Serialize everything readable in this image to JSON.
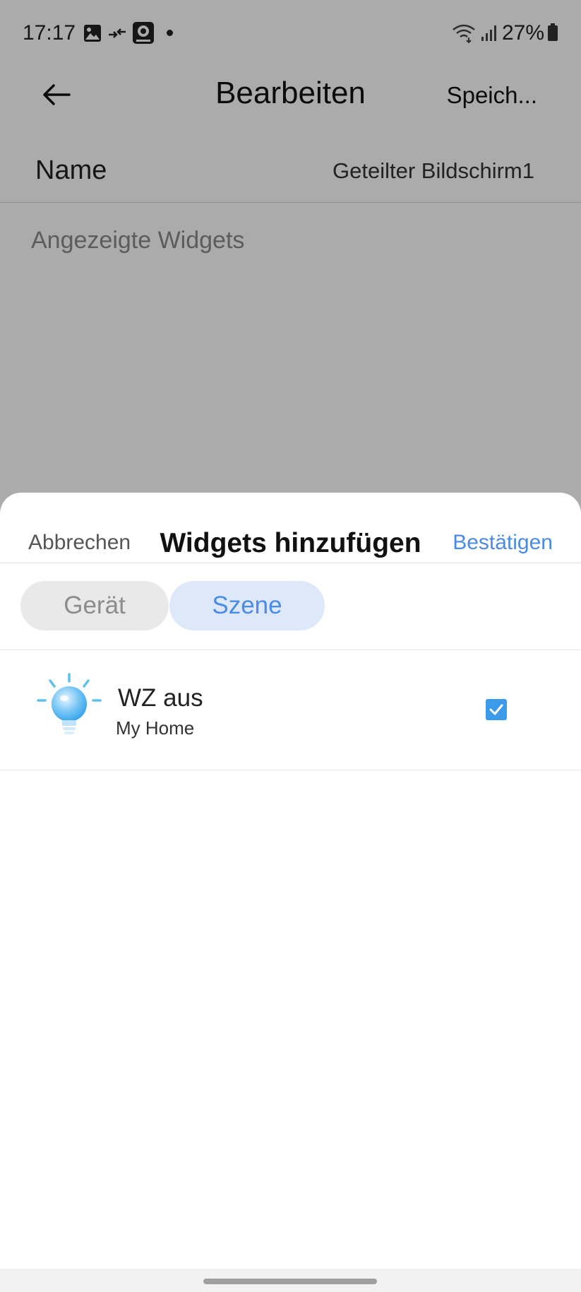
{
  "status_bar": {
    "time": "17:17",
    "battery": "27%",
    "icons": [
      "gallery-icon",
      "transfer-icon",
      "camera-app-icon",
      "wifi-icon",
      "signal-icon",
      "battery-icon"
    ]
  },
  "header": {
    "back_icon": "arrow-left-icon",
    "title": "Bearbeiten",
    "save_label": "Speich..."
  },
  "form": {
    "name_label": "Name",
    "name_value": "Geteilter Bildschirm1",
    "section_label": "Angezeigte Widgets"
  },
  "sheet": {
    "cancel_label": "Abbrechen",
    "title": "Widgets hinzufügen",
    "confirm_label": "Bestätigen",
    "tabs": [
      {
        "label": "Gerät",
        "active": false
      },
      {
        "label": "Szene",
        "active": true
      }
    ],
    "items": [
      {
        "title": "WZ aus",
        "subtitle": "My Home",
        "icon": "lightbulb-icon",
        "checked": true
      }
    ]
  },
  "colors": {
    "accent": "#4a8be6",
    "checkbox": "#3b9bea",
    "active_tab_bg": "#dde9f9",
    "inactive_tab_bg": "#e9e9e9"
  }
}
